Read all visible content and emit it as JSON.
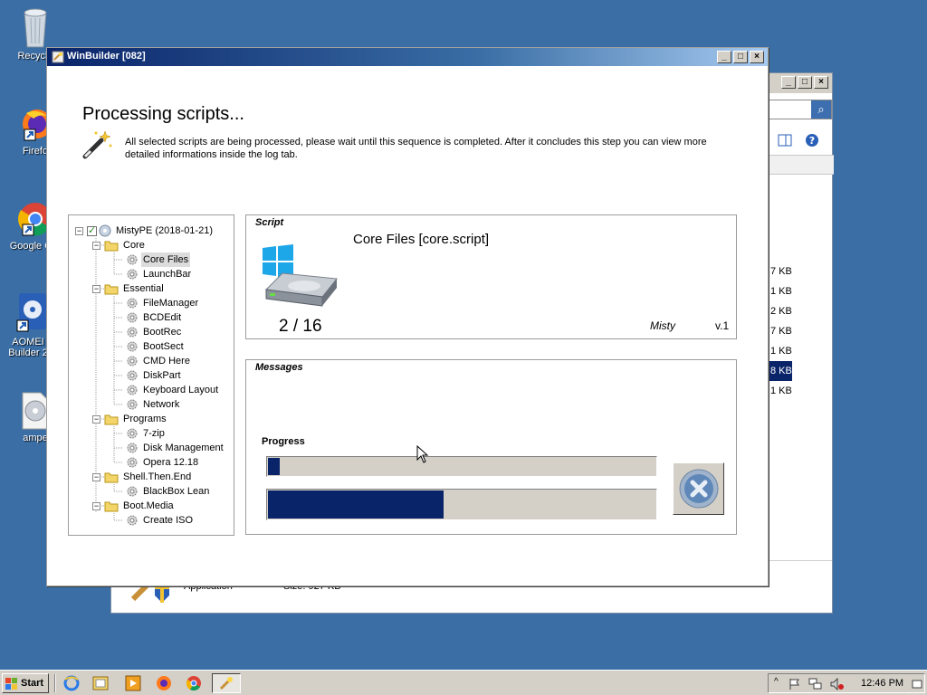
{
  "desktop": {
    "icons": [
      {
        "label": "Recycle"
      },
      {
        "label": "Firefo"
      },
      {
        "label": "Google Ch"
      },
      {
        "label": "AOMEI",
        "label2": "Builder 2"
      },
      {
        "label": "ampe"
      }
    ]
  },
  "background_window": {
    "sizes": [
      "7 KB",
      "1 KB",
      "2 KB",
      "7 KB",
      "1 KB",
      "8 KB",
      "1 KB"
    ],
    "selected_index": 5,
    "details": {
      "type": "Application",
      "size": "Size: 927 KB"
    }
  },
  "window": {
    "title": "WinBuilder [082]",
    "heading": "Processing scripts...",
    "description": "All selected scripts are being processed, please wait until this sequence is completed. After it concludes this step you can view more detailed informations inside the log tab."
  },
  "tree": {
    "root": "MistyPE (2018-01-21)",
    "folders": [
      {
        "name": "Core",
        "items": [
          "Core Files",
          "LaunchBar"
        ]
      },
      {
        "name": "Essential",
        "items": [
          "FileManager",
          "BCDEdit",
          "BootRec",
          "BootSect",
          "CMD Here",
          "DiskPart",
          "Keyboard Layout",
          "Network"
        ]
      },
      {
        "name": "Programs",
        "items": [
          "7-zip",
          "Disk Management",
          "Opera 12.18"
        ]
      },
      {
        "name": "Shell.Then.End",
        "items": [
          "BlackBox Lean"
        ]
      },
      {
        "name": "Boot.Media",
        "items": [
          "Create ISO"
        ]
      }
    ],
    "selected": "Core Files"
  },
  "script_panel": {
    "label": "Script",
    "name": "Core Files [core.script]",
    "count": "2 / 16",
    "author": "Misty",
    "version": "v.1"
  },
  "messages_panel": {
    "label": "Messages",
    "progress_label": "Progress",
    "progress_script": 0.03,
    "progress_overall": 0.45
  },
  "taskbar": {
    "start_label": "Start",
    "clock": "12:46 PM"
  }
}
